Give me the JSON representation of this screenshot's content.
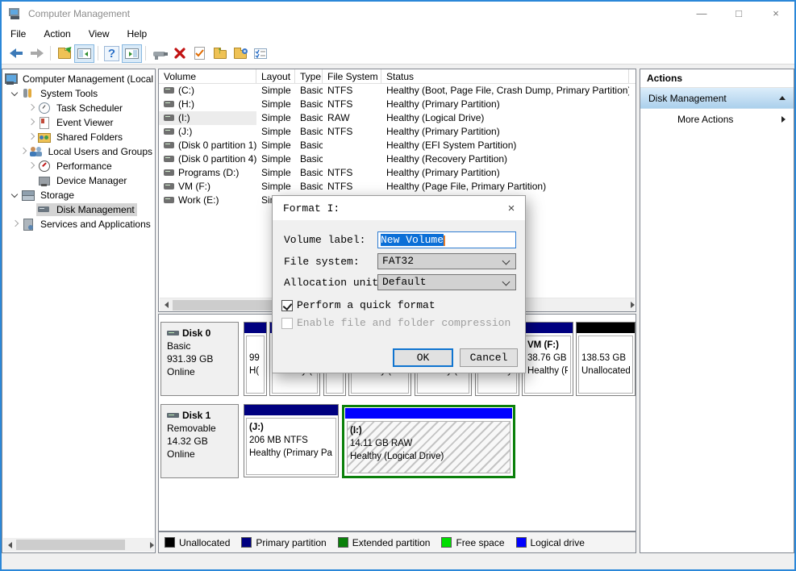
{
  "titlebar": {
    "title": "Computer Management",
    "minimize_icon": "—",
    "maximize_icon": "□",
    "close_icon": "×"
  },
  "menubar": {
    "items": [
      "File",
      "Action",
      "View",
      "Help"
    ]
  },
  "toolbar": {
    "icons": [
      "back",
      "forward",
      "export-list",
      "show-console-tree",
      "help",
      "show-action-pane",
      "rescan-disks",
      "delete-volume",
      "check-properties",
      "open-parent",
      "explore",
      "view-options"
    ],
    "help_glyph": "?"
  },
  "tree": {
    "items": [
      {
        "label": "Computer Management (Local"
      },
      {
        "label": "System Tools"
      },
      {
        "label": "Task Scheduler"
      },
      {
        "label": "Event Viewer"
      },
      {
        "label": "Shared Folders"
      },
      {
        "label": "Local Users and Groups"
      },
      {
        "label": "Performance"
      },
      {
        "label": "Device Manager"
      },
      {
        "label": "Storage"
      },
      {
        "label": "Disk Management"
      },
      {
        "label": "Services and Applications"
      }
    ]
  },
  "volume_list": {
    "columns": [
      "Volume",
      "Layout",
      "Type",
      "File System",
      "Status"
    ],
    "rows": [
      {
        "volume": "(C:)",
        "layout": "Simple",
        "type": "Basic",
        "fs": "NTFS",
        "status": "Healthy (Boot, Page File, Crash Dump, Primary Partition)"
      },
      {
        "volume": "(H:)",
        "layout": "Simple",
        "type": "Basic",
        "fs": "NTFS",
        "status": "Healthy (Primary Partition)"
      },
      {
        "volume": "(I:)",
        "layout": "Simple",
        "type": "Basic",
        "fs": "RAW",
        "status": "Healthy (Logical Drive)"
      },
      {
        "volume": "(J:)",
        "layout": "Simple",
        "type": "Basic",
        "fs": "NTFS",
        "status": "Healthy (Primary Partition)"
      },
      {
        "volume": "(Disk 0 partition 1)",
        "layout": "Simple",
        "type": "Basic",
        "fs": "",
        "status": "Healthy (EFI System Partition)"
      },
      {
        "volume": "(Disk 0 partition 4)",
        "layout": "Simple",
        "type": "Basic",
        "fs": "",
        "status": "Healthy (Recovery Partition)"
      },
      {
        "volume": "Programs (D:)",
        "layout": "Simple",
        "type": "Basic",
        "fs": "NTFS",
        "status": "Healthy (Primary Partition)"
      },
      {
        "volume": "VM (F:)",
        "layout": "Simple",
        "type": "Basic",
        "fs": "NTFS",
        "status": "Healthy (Page File, Primary Partition)"
      },
      {
        "volume": "Work (E:)",
        "layout": "Simple",
        "type": "",
        "fs": "",
        "status": ""
      }
    ]
  },
  "dialog": {
    "title": "Format I:",
    "close_icon": "×",
    "volume_label": {
      "label": "Volume label:",
      "value": "New Volume"
    },
    "file_system": {
      "label": "File system:",
      "value": "FAT32"
    },
    "allocation_unit": {
      "label": "Allocation unit",
      "value": "Default"
    },
    "quick_format": {
      "label": "Perform a quick format",
      "checked": true
    },
    "compression": {
      "label": "Enable file and folder compression",
      "checked": false
    },
    "ok_label": "OK",
    "cancel_label": "Cancel"
  },
  "graphical": {
    "disk0": {
      "label": "Disk 0",
      "kind": "Basic",
      "size": "931.39 GB",
      "status": "Online",
      "partitions": [
        {
          "l1": "",
          "l2": "99",
          "l3": "H(",
          "bar": "#000080"
        },
        {
          "l1": "",
          "l2": "",
          "l3": "Healthy (B",
          "bar": "#000080"
        },
        {
          "l1": "",
          "l2": "",
          "l3": "Free spa",
          "bar": "#000080"
        },
        {
          "l1": "",
          "l2": "",
          "l3": "Healthy (P",
          "bar": "#000080"
        },
        {
          "l1": "",
          "l2": "",
          "l3": "Healthy (P",
          "bar": "#000080"
        },
        {
          "l1": "",
          "l2": "",
          "l3": "Healthy",
          "bar": "#000080"
        },
        {
          "l1": "VM (F:)",
          "l2": "38.76 GB",
          "l3": "Healthy (P",
          "bar": "#000080"
        },
        {
          "l1": "",
          "l2": "138.53 GB",
          "l3": "Unallocated",
          "bar": "#000000"
        }
      ]
    },
    "disk1": {
      "label": "Disk 1",
      "kind": "Removable",
      "size": "14.32 GB",
      "status": "Online",
      "partitions": [
        {
          "l1": "(J:)",
          "l2": "206 MB NTFS",
          "l3": "Healthy (Primary Pa",
          "bar": "#000080"
        },
        {
          "l1": "(I:)",
          "l2": "14.11 GB RAW",
          "l3": "Healthy (Logical Drive)",
          "bar": "#0000ff"
        }
      ]
    }
  },
  "legend": {
    "items": [
      {
        "label": "Unallocated",
        "color": "#000000"
      },
      {
        "label": "Primary partition",
        "color": "#000080"
      },
      {
        "label": "Extended partition",
        "color": "#0a800a"
      },
      {
        "label": "Free space",
        "color": "#00dd00"
      },
      {
        "label": "Logical drive",
        "color": "#0000ff"
      }
    ]
  },
  "actions": {
    "title": "Actions",
    "section_label": "Disk Management",
    "more_label": "More Actions"
  }
}
